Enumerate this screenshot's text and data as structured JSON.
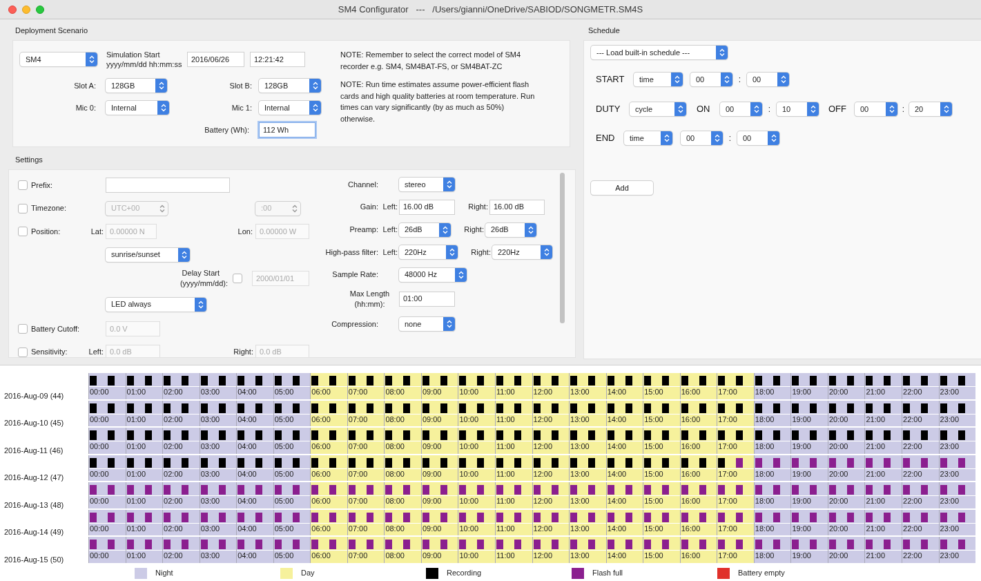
{
  "window": {
    "title": "SM4 Configurator   ---   /Users/gianni/OneDrive/SABIOD/SONGMETR.SM4S"
  },
  "deployment": {
    "title": "Deployment Scenario",
    "model": "SM4",
    "sim_start_label": "Simulation Start",
    "sim_start_format": "yyyy/mm/dd hh:mm:ss",
    "date": "2016/06/26",
    "time": "12:21:42",
    "slot_a": {
      "label": "Slot A:",
      "value": "128GB"
    },
    "slot_b": {
      "label": "Slot B:",
      "value": "128GB"
    },
    "mic_0": {
      "label": "Mic 0:",
      "value": "Internal"
    },
    "mic_1": {
      "label": "Mic 1:",
      "value": "Internal"
    },
    "battery": {
      "label": "Battery (Wh):",
      "value": "112 Wh",
      "focused": true
    },
    "notes": [
      "NOTE: Remember to select the correct model of SM4 recorder e.g. SM4, SM4BAT-FS, or SM4BAT-ZC",
      "NOTE: Run time estimates assume power-efficient flash cards and high quality batteries at room temperature. Run times can vary significantly (by as much as 50%) otherwise."
    ]
  },
  "settings": {
    "title": "Settings",
    "prefix": {
      "label": "Prefix:",
      "checked": false
    },
    "timezone": {
      "label": "Timezone:",
      "checked": false,
      "zone": "UTC+00",
      "offset": ":00"
    },
    "position": {
      "label": "Position:",
      "checked": false,
      "lat_label": "Lat:",
      "lat": "0.00000 N",
      "lon_label": "Lon:",
      "lon": "0.00000 W"
    },
    "sun_mode": "sunrise/sunset",
    "delay_start": {
      "label": "Delay Start",
      "format": "(yyyy/mm/dd):",
      "checked": false,
      "value": "2000/01/01"
    },
    "led_mode": "LED always",
    "battery_cutoff": {
      "label": "Battery Cutoff:",
      "checked": false,
      "value": "0.0 V"
    },
    "sensitivity": {
      "label": "Sensitivity:",
      "checked": false,
      "left_label": "Left:",
      "left": "0.0 dB",
      "right_label": "Right:",
      "right": "0.0 dB"
    },
    "channel": {
      "label": "Channel:",
      "value": "stereo"
    },
    "gain": {
      "label": "Gain:",
      "left_label": "Left:",
      "left": "16.00 dB",
      "right_label": "Right:",
      "right": "16.00 dB"
    },
    "preamp": {
      "label": "Preamp:",
      "left_label": "Left:",
      "left": "26dB",
      "right_label": "Right:",
      "right": "26dB"
    },
    "high_pass": {
      "label": "High-pass filter:",
      "left_label": "Left:",
      "left": "220Hz",
      "right_label": "Right:",
      "right": "220Hz"
    },
    "sample_rate": {
      "label": "Sample Rate:",
      "value": "48000 Hz"
    },
    "max_length": {
      "label": "Max Length",
      "format": "(hh:mm):",
      "value": "01:00"
    },
    "compression": {
      "label": "Compression:",
      "value": "none"
    }
  },
  "schedule": {
    "title": "Schedule",
    "preset": "--- Load built-in schedule ---",
    "start": {
      "label": "START",
      "mode": "time",
      "hour": "00",
      "separator": ":",
      "minute": "00"
    },
    "duty": {
      "label": "DUTY",
      "mode": "cycle",
      "on_label": "ON",
      "on": {
        "hour": "00",
        "separator": ":",
        "minute": "10"
      },
      "off_label": "OFF",
      "off": {
        "hour": "00",
        "separator": ":",
        "minute": "20"
      }
    },
    "end": {
      "label": "END",
      "mode": "time",
      "hour": "00",
      "separator": ":",
      "minute": "00"
    },
    "add_button": "Add"
  },
  "timeline": {
    "hours": [
      {
        "day": false
      },
      {
        "day": false
      },
      {
        "day": false
      },
      {
        "day": false
      },
      {
        "day": false
      },
      {
        "day": false
      },
      {
        "day": true
      },
      {
        "day": true
      },
      {
        "day": true
      },
      {
        "day": true
      },
      {
        "day": true
      },
      {
        "day": true
      },
      {
        "day": true
      },
      {
        "day": true
      },
      {
        "day": true
      },
      {
        "day": true
      },
      {
        "day": true
      },
      {
        "day": true
      },
      {
        "day": false
      },
      {
        "day": false
      },
      {
        "day": false
      },
      {
        "day": false
      },
      {
        "day": false
      },
      {
        "day": false
      }
    ],
    "rows": [
      {
        "label": "2016-Aug-09 (44)",
        "times": [
          "00:00",
          "01:00",
          "02:00",
          "03:00",
          "04:00",
          "05:00",
          "06:00",
          "07:00",
          "08:00",
          "09:00",
          "10:00",
          "11:00",
          "12:00",
          "13:00",
          "14:00",
          "15:00",
          "16:00",
          "17:00",
          "18:00",
          "19:00",
          "20:00",
          "21:00",
          "22:00",
          "23:00"
        ],
        "marks": [
          {
            "flash_full": false
          },
          {
            "flash_full": false
          },
          {
            "flash_full": false
          },
          {
            "flash_full": false
          },
          {
            "flash_full": false
          },
          {
            "flash_full": false
          },
          {
            "flash_full": false
          },
          {
            "flash_full": false
          },
          {
            "flash_full": false
          },
          {
            "flash_full": false
          },
          {
            "flash_full": false
          },
          {
            "flash_full": false
          },
          {
            "flash_full": false
          },
          {
            "flash_full": false
          },
          {
            "flash_full": false
          },
          {
            "flash_full": false
          },
          {
            "flash_full": false
          },
          {
            "flash_full": false
          },
          {
            "flash_full": false
          },
          {
            "flash_full": false
          },
          {
            "flash_full": false
          },
          {
            "flash_full": false
          },
          {
            "flash_full": false
          },
          {
            "flash_full": false
          },
          {
            "flash_full": false
          },
          {
            "flash_full": false
          },
          {
            "flash_full": false
          },
          {
            "flash_full": false
          },
          {
            "flash_full": false
          },
          {
            "flash_full": false
          },
          {
            "flash_full": false
          },
          {
            "flash_full": false
          },
          {
            "flash_full": false
          },
          {
            "flash_full": false
          },
          {
            "flash_full": false
          },
          {
            "flash_full": false
          },
          {
            "flash_full": false
          },
          {
            "flash_full": false
          },
          {
            "flash_full": false
          },
          {
            "flash_full": false
          },
          {
            "flash_full": false
          },
          {
            "flash_full": false
          },
          {
            "flash_full": false
          },
          {
            "flash_full": false
          },
          {
            "flash_full": false
          },
          {
            "flash_full": false
          },
          {
            "flash_full": false
          },
          {
            "flash_full": false
          }
        ]
      },
      {
        "label": "2016-Aug-10 (45)",
        "times": [
          "00:00",
          "01:00",
          "02:00",
          "03:00",
          "04:00",
          "05:00",
          "06:00",
          "07:00",
          "08:00",
          "09:00",
          "10:00",
          "11:00",
          "12:00",
          "13:00",
          "14:00",
          "15:00",
          "16:00",
          "17:00",
          "18:00",
          "19:00",
          "20:00",
          "21:00",
          "22:00",
          "23:00"
        ],
        "marks": [
          {
            "flash_full": false
          },
          {
            "flash_full": false
          },
          {
            "flash_full": false
          },
          {
            "flash_full": false
          },
          {
            "flash_full": false
          },
          {
            "flash_full": false
          },
          {
            "flash_full": false
          },
          {
            "flash_full": false
          },
          {
            "flash_full": false
          },
          {
            "flash_full": false
          },
          {
            "flash_full": false
          },
          {
            "flash_full": false
          },
          {
            "flash_full": false
          },
          {
            "flash_full": false
          },
          {
            "flash_full": false
          },
          {
            "flash_full": false
          },
          {
            "flash_full": false
          },
          {
            "flash_full": false
          },
          {
            "flash_full": false
          },
          {
            "flash_full": false
          },
          {
            "flash_full": false
          },
          {
            "flash_full": false
          },
          {
            "flash_full": false
          },
          {
            "flash_full": false
          },
          {
            "flash_full": false
          },
          {
            "flash_full": false
          },
          {
            "flash_full": false
          },
          {
            "flash_full": false
          },
          {
            "flash_full": false
          },
          {
            "flash_full": false
          },
          {
            "flash_full": false
          },
          {
            "flash_full": false
          },
          {
            "flash_full": false
          },
          {
            "flash_full": false
          },
          {
            "flash_full": false
          },
          {
            "flash_full": false
          },
          {
            "flash_full": false
          },
          {
            "flash_full": false
          },
          {
            "flash_full": false
          },
          {
            "flash_full": false
          },
          {
            "flash_full": false
          },
          {
            "flash_full": false
          },
          {
            "flash_full": false
          },
          {
            "flash_full": false
          },
          {
            "flash_full": false
          },
          {
            "flash_full": false
          },
          {
            "flash_full": false
          },
          {
            "flash_full": false
          }
        ]
      },
      {
        "label": "2016-Aug-11 (46)",
        "times": [
          "00:00",
          "01:00",
          "02:00",
          "03:00",
          "04:00",
          "05:00",
          "06:00",
          "07:00",
          "08:00",
          "09:00",
          "10:00",
          "11:00",
          "12:00",
          "13:00",
          "14:00",
          "15:00",
          "16:00",
          "17:00",
          "18:00",
          "19:00",
          "20:00",
          "21:00",
          "22:00",
          "23:00"
        ],
        "marks": [
          {
            "flash_full": false
          },
          {
            "flash_full": false
          },
          {
            "flash_full": false
          },
          {
            "flash_full": false
          },
          {
            "flash_full": false
          },
          {
            "flash_full": false
          },
          {
            "flash_full": false
          },
          {
            "flash_full": false
          },
          {
            "flash_full": false
          },
          {
            "flash_full": false
          },
          {
            "flash_full": false
          },
          {
            "flash_full": false
          },
          {
            "flash_full": false
          },
          {
            "flash_full": false
          },
          {
            "flash_full": false
          },
          {
            "flash_full": false
          },
          {
            "flash_full": false
          },
          {
            "flash_full": false
          },
          {
            "flash_full": false
          },
          {
            "flash_full": false
          },
          {
            "flash_full": false
          },
          {
            "flash_full": false
          },
          {
            "flash_full": false
          },
          {
            "flash_full": false
          },
          {
            "flash_full": false
          },
          {
            "flash_full": false
          },
          {
            "flash_full": false
          },
          {
            "flash_full": false
          },
          {
            "flash_full": false
          },
          {
            "flash_full": false
          },
          {
            "flash_full": false
          },
          {
            "flash_full": false
          },
          {
            "flash_full": false
          },
          {
            "flash_full": false
          },
          {
            "flash_full": false
          },
          {
            "flash_full": false
          },
          {
            "flash_full": false
          },
          {
            "flash_full": false
          },
          {
            "flash_full": false
          },
          {
            "flash_full": false
          },
          {
            "flash_full": false
          },
          {
            "flash_full": false
          },
          {
            "flash_full": false
          },
          {
            "flash_full": false
          },
          {
            "flash_full": false
          },
          {
            "flash_full": false
          },
          {
            "flash_full": false
          },
          {
            "flash_full": false
          }
        ]
      },
      {
        "label": "2016-Aug-12 (47)",
        "times": [
          "00:00",
          "01:00",
          "02:00",
          "03:00",
          "04:00",
          "05:00",
          "06:00",
          "07:00",
          "08:00",
          "09:00",
          "10:00",
          "11:00",
          "12:00",
          "13:00",
          "14:00",
          "15:00",
          "16:00",
          "17:00",
          "18:00",
          "19:00",
          "20:00",
          "21:00",
          "22:00",
          "23:00"
        ],
        "marks": [
          {
            "flash_full": false
          },
          {
            "flash_full": false
          },
          {
            "flash_full": false
          },
          {
            "flash_full": false
          },
          {
            "flash_full": false
          },
          {
            "flash_full": false
          },
          {
            "flash_full": false
          },
          {
            "flash_full": false
          },
          {
            "flash_full": false
          },
          {
            "flash_full": false
          },
          {
            "flash_full": false
          },
          {
            "flash_full": false
          },
          {
            "flash_full": false
          },
          {
            "flash_full": false
          },
          {
            "flash_full": false
          },
          {
            "flash_full": false
          },
          {
            "flash_full": false
          },
          {
            "flash_full": false
          },
          {
            "flash_full": false
          },
          {
            "flash_full": false
          },
          {
            "flash_full": false
          },
          {
            "flash_full": false
          },
          {
            "flash_full": false
          },
          {
            "flash_full": false
          },
          {
            "flash_full": false
          },
          {
            "flash_full": false
          },
          {
            "flash_full": false
          },
          {
            "flash_full": false
          },
          {
            "flash_full": false
          },
          {
            "flash_full": false
          },
          {
            "flash_full": false
          },
          {
            "flash_full": false
          },
          {
            "flash_full": false
          },
          {
            "flash_full": false
          },
          {
            "flash_full": false
          },
          {
            "flash_full": true
          },
          {
            "flash_full": true
          },
          {
            "flash_full": true
          },
          {
            "flash_full": true
          },
          {
            "flash_full": true
          },
          {
            "flash_full": true
          },
          {
            "flash_full": true
          },
          {
            "flash_full": true
          },
          {
            "flash_full": true
          },
          {
            "flash_full": true
          },
          {
            "flash_full": true
          },
          {
            "flash_full": true
          },
          {
            "flash_full": true
          }
        ]
      },
      {
        "label": "2016-Aug-13 (48)",
        "times": [
          "00:00",
          "01:00",
          "02:00",
          "03:00",
          "04:00",
          "05:00",
          "06:00",
          "07:00",
          "08:00",
          "09:00",
          "10:00",
          "11:00",
          "12:00",
          "13:00",
          "14:00",
          "15:00",
          "16:00",
          "17:00",
          "18:00",
          "19:00",
          "20:00",
          "21:00",
          "22:00",
          "23:00"
        ],
        "marks": [
          {
            "flash_full": true
          },
          {
            "flash_full": true
          },
          {
            "flash_full": true
          },
          {
            "flash_full": true
          },
          {
            "flash_full": true
          },
          {
            "flash_full": true
          },
          {
            "flash_full": true
          },
          {
            "flash_full": true
          },
          {
            "flash_full": true
          },
          {
            "flash_full": true
          },
          {
            "flash_full": true
          },
          {
            "flash_full": true
          },
          {
            "flash_full": true
          },
          {
            "flash_full": true
          },
          {
            "flash_full": true
          },
          {
            "flash_full": true
          },
          {
            "flash_full": true
          },
          {
            "flash_full": true
          },
          {
            "flash_full": true
          },
          {
            "flash_full": true
          },
          {
            "flash_full": true
          },
          {
            "flash_full": true
          },
          {
            "flash_full": true
          },
          {
            "flash_full": true
          },
          {
            "flash_full": true
          },
          {
            "flash_full": true
          },
          {
            "flash_full": true
          },
          {
            "flash_full": true
          },
          {
            "flash_full": true
          },
          {
            "flash_full": true
          },
          {
            "flash_full": true
          },
          {
            "flash_full": true
          },
          {
            "flash_full": true
          },
          {
            "flash_full": true
          },
          {
            "flash_full": true
          },
          {
            "flash_full": true
          },
          {
            "flash_full": true
          },
          {
            "flash_full": true
          },
          {
            "flash_full": true
          },
          {
            "flash_full": true
          },
          {
            "flash_full": true
          },
          {
            "flash_full": true
          },
          {
            "flash_full": true
          },
          {
            "flash_full": true
          },
          {
            "flash_full": true
          },
          {
            "flash_full": true
          },
          {
            "flash_full": true
          },
          {
            "flash_full": true
          }
        ]
      },
      {
        "label": "2016-Aug-14 (49)",
        "times": [
          "00:00",
          "01:00",
          "02:00",
          "03:00",
          "04:00",
          "05:00",
          "06:00",
          "07:00",
          "08:00",
          "09:00",
          "10:00",
          "11:00",
          "12:00",
          "13:00",
          "14:00",
          "15:00",
          "16:00",
          "17:00",
          "18:00",
          "19:00",
          "20:00",
          "21:00",
          "22:00",
          "23:00"
        ],
        "marks": [
          {
            "flash_full": true
          },
          {
            "flash_full": true
          },
          {
            "flash_full": true
          },
          {
            "flash_full": true
          },
          {
            "flash_full": true
          },
          {
            "flash_full": true
          },
          {
            "flash_full": true
          },
          {
            "flash_full": true
          },
          {
            "flash_full": true
          },
          {
            "flash_full": true
          },
          {
            "flash_full": true
          },
          {
            "flash_full": true
          },
          {
            "flash_full": true
          },
          {
            "flash_full": true
          },
          {
            "flash_full": true
          },
          {
            "flash_full": true
          },
          {
            "flash_full": true
          },
          {
            "flash_full": true
          },
          {
            "flash_full": true
          },
          {
            "flash_full": true
          },
          {
            "flash_full": true
          },
          {
            "flash_full": true
          },
          {
            "flash_full": true
          },
          {
            "flash_full": true
          },
          {
            "flash_full": true
          },
          {
            "flash_full": true
          },
          {
            "flash_full": true
          },
          {
            "flash_full": true
          },
          {
            "flash_full": true
          },
          {
            "flash_full": true
          },
          {
            "flash_full": true
          },
          {
            "flash_full": true
          },
          {
            "flash_full": true
          },
          {
            "flash_full": true
          },
          {
            "flash_full": true
          },
          {
            "flash_full": true
          },
          {
            "flash_full": true
          },
          {
            "flash_full": true
          },
          {
            "flash_full": true
          },
          {
            "flash_full": true
          },
          {
            "flash_full": true
          },
          {
            "flash_full": true
          },
          {
            "flash_full": true
          },
          {
            "flash_full": true
          },
          {
            "flash_full": true
          },
          {
            "flash_full": true
          },
          {
            "flash_full": true
          },
          {
            "flash_full": true
          }
        ]
      },
      {
        "label": "2016-Aug-15 (50)",
        "times": [
          "00:00",
          "01:00",
          "02:00",
          "03:00",
          "04:00",
          "05:00",
          "06:00",
          "07:00",
          "08:00",
          "09:00",
          "10:00",
          "11:00",
          "12:00",
          "13:00",
          "14:00",
          "15:00",
          "16:00",
          "17:00",
          "18:00",
          "19:00",
          "20:00",
          "21:00",
          "22:00",
          "23:00"
        ],
        "marks": [
          {
            "flash_full": true
          },
          {
            "flash_full": true
          },
          {
            "flash_full": true
          },
          {
            "flash_full": true
          },
          {
            "flash_full": true
          },
          {
            "flash_full": true
          },
          {
            "flash_full": true
          },
          {
            "flash_full": true
          },
          {
            "flash_full": true
          },
          {
            "flash_full": true
          },
          {
            "flash_full": true
          },
          {
            "flash_full": true
          },
          {
            "flash_full": true
          },
          {
            "flash_full": true
          },
          {
            "flash_full": true
          },
          {
            "flash_full": true
          },
          {
            "flash_full": true
          },
          {
            "flash_full": true
          },
          {
            "flash_full": true
          },
          {
            "flash_full": true
          },
          {
            "flash_full": true
          },
          {
            "flash_full": true
          },
          {
            "flash_full": true
          },
          {
            "flash_full": true
          },
          {
            "flash_full": true
          },
          {
            "flash_full": true
          },
          {
            "flash_full": true
          },
          {
            "flash_full": true
          },
          {
            "flash_full": true
          },
          {
            "flash_full": true
          },
          {
            "flash_full": true
          },
          {
            "flash_full": true
          },
          {
            "flash_full": true
          },
          {
            "flash_full": true
          },
          {
            "flash_full": true
          },
          {
            "flash_full": true
          },
          {
            "flash_full": true
          },
          {
            "flash_full": true
          },
          {
            "flash_full": true
          },
          {
            "flash_full": true
          },
          {
            "flash_full": true
          },
          {
            "flash_full": true
          },
          {
            "flash_full": true
          },
          {
            "flash_full": true
          },
          {
            "flash_full": true
          },
          {
            "flash_full": true
          },
          {
            "flash_full": true
          },
          {
            "flash_full": true
          }
        ]
      }
    ],
    "legend": [
      {
        "kind": "night",
        "label": "Night",
        "color": "#cccbe6"
      },
      {
        "kind": "day",
        "label": "Day",
        "color": "#f6f19c"
      },
      {
        "kind": "recording",
        "label": "Recording",
        "color": "#000000"
      },
      {
        "kind": "flash_full",
        "label": "Flash full",
        "color": "#8b1f8f"
      },
      {
        "kind": "battery_empty",
        "label": "Battery empty",
        "color": "#e0302a"
      }
    ]
  }
}
